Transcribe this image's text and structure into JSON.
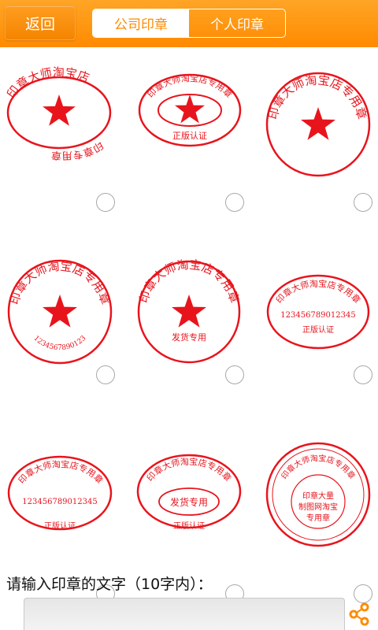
{
  "topbar": {
    "back_label": "返回",
    "tabs": [
      {
        "label": "公司印章",
        "active": true
      },
      {
        "label": "个人印章",
        "active": false
      }
    ],
    "accent": "#ff8a00"
  },
  "stamp_color": "#e8141c",
  "stamps": [
    {
      "shape": "ellipse",
      "arc_text": "印章大师淘宝店",
      "bottom_arc": "印章专用章",
      "star": true
    },
    {
      "shape": "double-ellipse",
      "arc_text": "印章大师淘宝店专用章",
      "bottom_text": "正版认证",
      "star": true
    },
    {
      "shape": "circle",
      "arc_text": "印章大师淘宝店专用章",
      "star": true
    },
    {
      "shape": "circle",
      "arc_text": "印章大师淘宝店专用章",
      "bottom_arc": "1234567890123",
      "star": true
    },
    {
      "shape": "circle",
      "arc_text": "印章大师淘宝店专用章",
      "bottom_text": "发货专用",
      "star": true
    },
    {
      "shape": "ellipse",
      "arc_text": "印章大师淘宝店专用章",
      "center_text": "123456789012345",
      "bottom_text": "正版认证",
      "star": false
    },
    {
      "shape": "ellipse",
      "arc_text": "印章大师淘宝店专用章",
      "center_text": "123456789012345",
      "bottom_text": "正版认证",
      "star": false
    },
    {
      "shape": "double-ellipse",
      "arc_text": "印章大师淘宝店专用章",
      "center_text": "发货专用",
      "bottom_text": "正版认证",
      "star": false
    },
    {
      "shape": "double-circle",
      "arc_text": "印章大师淘宝店专用章",
      "center_lines": [
        "印章大量",
        "制图网淘宝",
        "专用章"
      ],
      "star": false
    }
  ],
  "input": {
    "label": "请输入印章的文字（10字内）：",
    "value": "",
    "placeholder": ""
  },
  "icons": {
    "share": "share-icon",
    "radio": "radio-button"
  }
}
